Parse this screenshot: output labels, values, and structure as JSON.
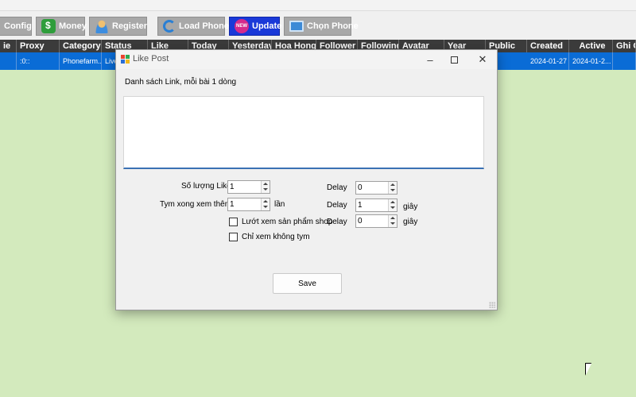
{
  "toolbar": {
    "buttons": [
      {
        "label": "Config",
        "icon": "config-icon"
      },
      {
        "label": "Money",
        "icon": "money-icon"
      },
      {
        "label": "Register",
        "icon": "user-icon"
      },
      {
        "label": "Load Phone",
        "icon": "refresh-icon"
      },
      {
        "label": "Update",
        "icon": "new-badge-icon"
      },
      {
        "label": "Chọn Phone",
        "icon": "monitor-icon"
      }
    ]
  },
  "grid": {
    "columns": [
      "ie",
      "Proxy",
      "Category",
      "Status",
      "Like",
      "Today",
      "Yesterday",
      "Hoa Hong",
      "Follower",
      "Following",
      "Avatar",
      "Year",
      "Public",
      "Created",
      "Active",
      "Ghi C"
    ],
    "row": {
      "proxy": ":0::",
      "category": "Phonefarm...",
      "status": "Live",
      "created": "2024-01-27",
      "active": "2024-01-2..."
    }
  },
  "dialog": {
    "title": "Like Post",
    "links_label": "Danh sách Link, mỗi bài 1 dòng",
    "links_value": "",
    "like_count_label": "Số lượng Like",
    "like_count_value": "1",
    "tym_label": "Tym xong xem thêm",
    "tym_value": "1",
    "tym_unit": "lần",
    "delay_label": "Delay",
    "delay1_value": "0",
    "delay2_value": "1",
    "delay2_unit": "giây",
    "delay3_value": "0",
    "delay3_unit": "giây",
    "check_shop_label": "Lướt xem sản phẩm shop",
    "check_shop_checked": false,
    "check_notym_label": "Chỉ xem không tym",
    "check_notym_checked": false,
    "save_label": "Save"
  },
  "colors": {
    "background": "#d3eabd",
    "grid_header": "#3b3b3b",
    "selected_row": "#0a6cd6",
    "update_button": "#1a39d8",
    "toolbar_button": "#a8a8a8"
  }
}
